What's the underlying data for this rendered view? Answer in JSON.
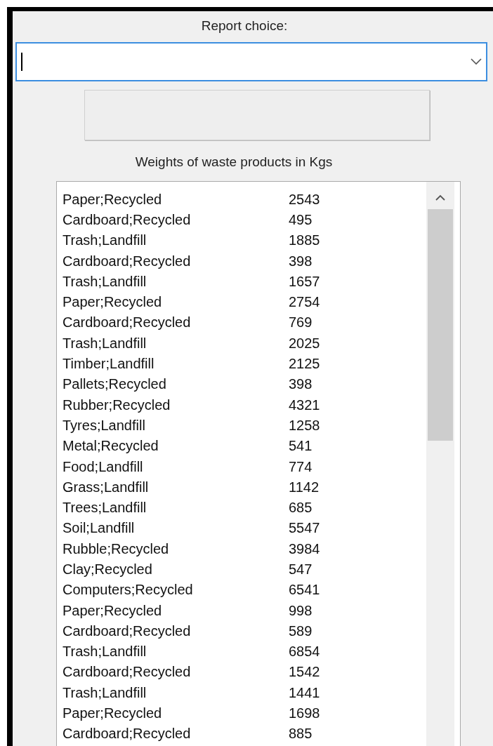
{
  "report_label": "Report choice:",
  "list_label": "Weights of waste products in Kgs",
  "rows": [
    {
      "item": "Paper;Recycled",
      "weight": "2543"
    },
    {
      "item": "Cardboard;Recycled",
      "weight": "495"
    },
    {
      "item": "Trash;Landfill",
      "weight": "1885"
    },
    {
      "item": "Cardboard;Recycled",
      "weight": "398"
    },
    {
      "item": "Trash;Landfill",
      "weight": "1657"
    },
    {
      "item": "Paper;Recycled",
      "weight": "2754"
    },
    {
      "item": "Cardboard;Recycled",
      "weight": "769"
    },
    {
      "item": "Trash;Landfill",
      "weight": "2025"
    },
    {
      "item": "Timber;Landfill",
      "weight": "2125"
    },
    {
      "item": "Pallets;Recycled",
      "weight": "398"
    },
    {
      "item": "Rubber;Recycled",
      "weight": "4321"
    },
    {
      "item": "Tyres;Landfill",
      "weight": "1258"
    },
    {
      "item": "Metal;Recycled",
      "weight": "541"
    },
    {
      "item": "Food;Landfill",
      "weight": "774"
    },
    {
      "item": "Grass;Landfill",
      "weight": "1142"
    },
    {
      "item": "Trees;Landfill",
      "weight": "685"
    },
    {
      "item": "Soil;Landfill",
      "weight": "5547"
    },
    {
      "item": "Rubble;Recycled",
      "weight": "3984"
    },
    {
      "item": "Clay;Recycled",
      "weight": "547"
    },
    {
      "item": "Computers;Recycled",
      "weight": "6541"
    },
    {
      "item": "Paper;Recycled",
      "weight": "998"
    },
    {
      "item": "Cardboard;Recycled",
      "weight": "589"
    },
    {
      "item": "Trash;Landfill",
      "weight": "6854"
    },
    {
      "item": "Cardboard;Recycled",
      "weight": "1542"
    },
    {
      "item": "Trash;Landfill",
      "weight": "1441"
    },
    {
      "item": "Paper;Recycled",
      "weight": "1698"
    },
    {
      "item": "Cardboard;Recycled",
      "weight": "885"
    }
  ]
}
